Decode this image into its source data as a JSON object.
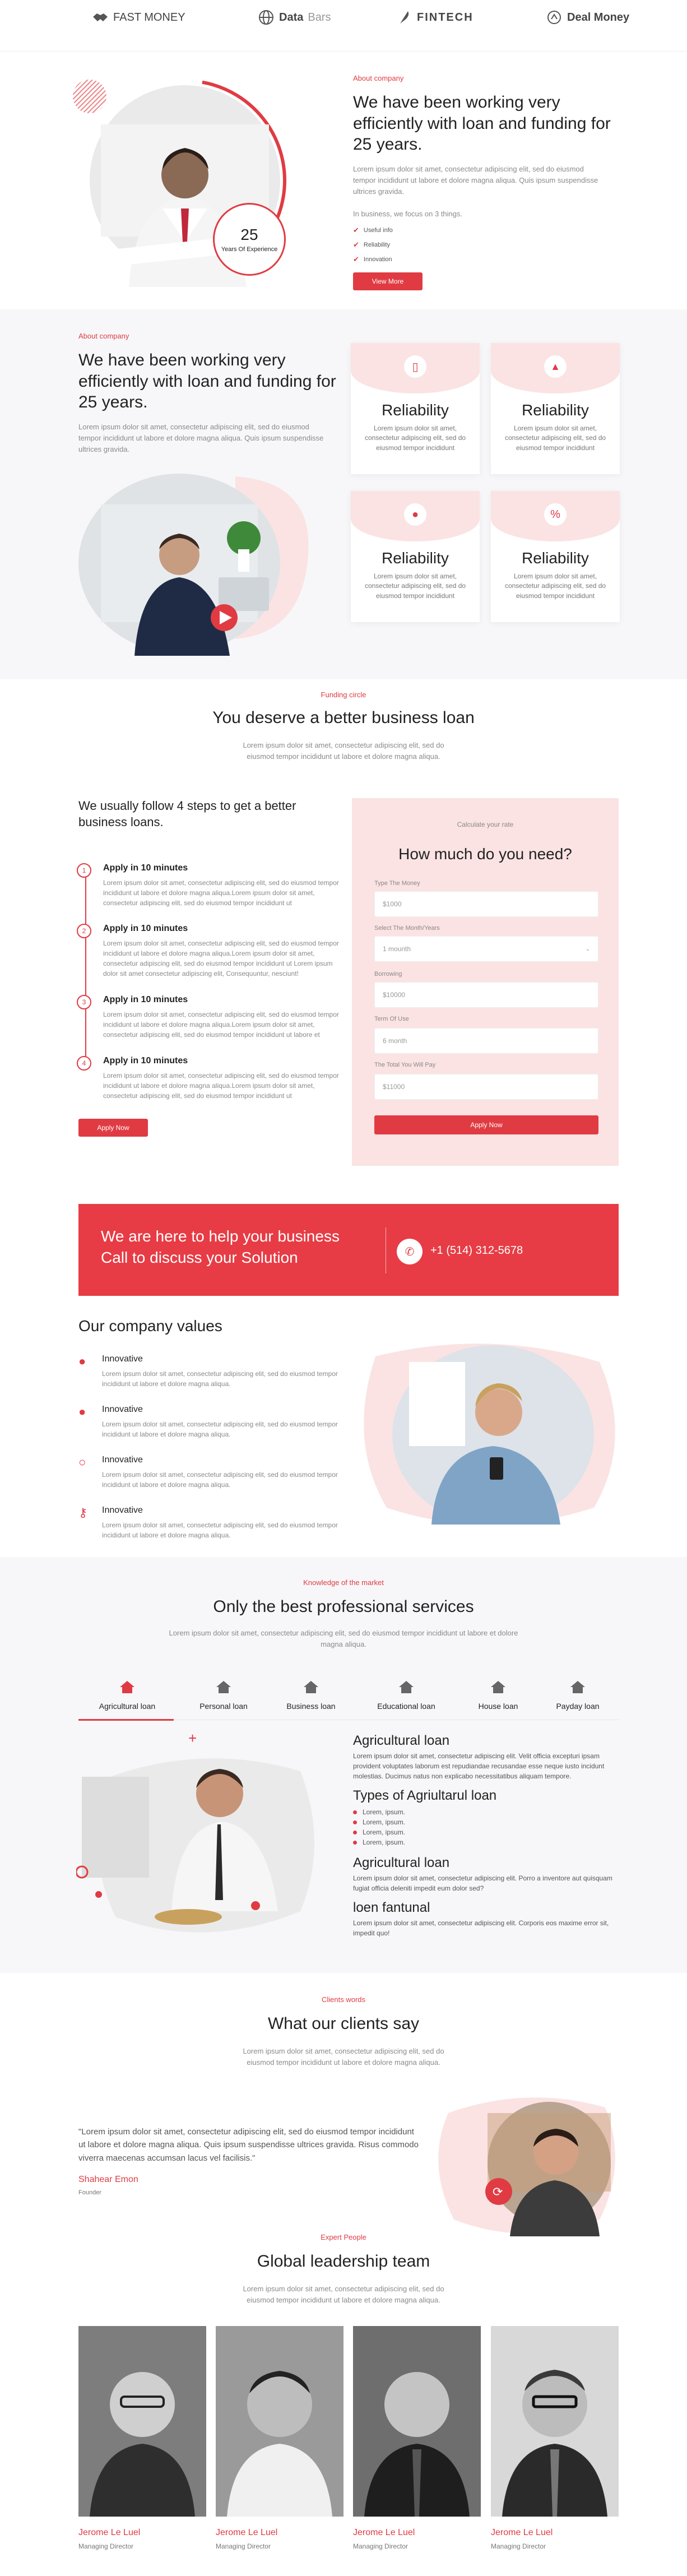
{
  "logos": [
    {
      "name": "FAST MONEY"
    },
    {
      "name_bold": "Data",
      "name_light": "Bars"
    },
    {
      "name": "FINTECH"
    },
    {
      "name": "Deal Money"
    }
  ],
  "about1": {
    "eyebrow": "About company",
    "title": "We have been working very efficiently with loan and funding for 25 years.",
    "body": "Lorem ipsum dolor sit amet, consectetur adipiscing elit, sed do eiusmod tempor incididunt ut labore et dolore magna aliqua. Quis ipsum suspendisse ultrices gravida.",
    "focus": "In business, we focus on 3 things.",
    "checks": [
      "Useful info",
      "Reliability",
      "Innovation"
    ],
    "button": "View More",
    "badge_num": "25",
    "badge_text": "Years Of Experience"
  },
  "about2": {
    "eyebrow": "About company",
    "title": "We have been working very efficiently with loan and funding for 25 years.",
    "body": "Lorem ipsum dolor sit amet, consectetur adipiscing elit, sed do eiusmod tempor incididunt ut labore et dolore magna aliqua. Quis ipsum suspendisse ultrices gravida.",
    "cards": [
      {
        "title": "Reliability",
        "desc": "Lorem ipsum dolor sit amet, consectetur adipiscing elit, sed do eiusmod tempor incididunt",
        "icon": "phone-icon"
      },
      {
        "title": "Reliability",
        "desc": "Lorem ipsum dolor sit amet, consectetur adipiscing elit, sed do eiusmod tempor incididunt",
        "icon": "rocket-icon"
      },
      {
        "title": "Reliability",
        "desc": "Lorem ipsum dolor sit amet, consectetur adipiscing elit, sed do eiusmod tempor incididunt",
        "icon": "apple-icon"
      },
      {
        "title": "Reliability",
        "desc": "Lorem ipsum dolor sit amet, consectetur adipiscing elit, sed do eiusmod tempor incididunt",
        "icon": "percent-icon"
      }
    ]
  },
  "funding": {
    "eyebrow": "Funding circle",
    "title": "You deserve a better business loan",
    "body": "Lorem ipsum dolor sit amet, consectetur adipiscing elit, sed do eiusmod tempor incididunt ut labore et dolore magna aliqua."
  },
  "steps": {
    "title": "We usually follow 4 steps to get a better business loans.",
    "items": [
      {
        "num": "1",
        "title": "Apply in 10 minutes",
        "desc": "Lorem ipsum dolor sit amet, consectetur adipiscing elit, sed do eiusmod tempor incididunt ut labore et dolore magna aliqua.Lorem ipsum dolor sit amet, consectetur adipiscing elit, sed do eiusmod tempor incididunt ut"
      },
      {
        "num": "2",
        "title": "Apply in 10 minutes",
        "desc": "Lorem ipsum dolor sit amet, consectetur adipiscing elit, sed do eiusmod tempor incididunt ut labore et dolore magna aliqua.Lorem ipsum dolor sit amet, consectetur adipiscing elit, sed do eiusmod tempor incididunt ut Lorem ipsum dolor sit amet consectetur adipiscing elit, Consequuntur, nesciunt!"
      },
      {
        "num": "3",
        "title": "Apply in 10 minutes",
        "desc": "Lorem ipsum dolor sit amet, consectetur adipiscing elit, sed do eiusmod tempor incididunt ut labore et dolore magna aliqua.Lorem ipsum dolor sit amet, consectetur adipiscing elit, sed do eiusmod tempor incididunt ut labore et"
      },
      {
        "num": "4",
        "title": "Apply in 10 minutes",
        "desc": "Lorem ipsum dolor sit amet, consectetur adipiscing elit, sed do eiusmod tempor incididunt ut labore et dolore magna aliqua.Lorem ipsum dolor sit amet, consectetur adipiscing elit, sed do eiusmod tempor incididunt ut"
      }
    ],
    "button": "Apply Now"
  },
  "calc": {
    "eyebrow": "Calculate your rate",
    "title": "How much do you need?",
    "fields": [
      {
        "label": "Type The Money",
        "value": "$1000"
      },
      {
        "label": "Select The Month/Years",
        "value": "1 mounth"
      },
      {
        "label": "Borrowing",
        "value": "$10000"
      },
      {
        "label": "Term Of Use",
        "value": "6 month"
      },
      {
        "label": "The Total You Will Pay",
        "value": "$11000"
      }
    ],
    "button": "Apply Now"
  },
  "cta": {
    "line1": "We are here to help your business",
    "line2": "Call to discuss your Solution",
    "phone": "+1 (514) 312-5678"
  },
  "values": {
    "title": "Our company values",
    "items": [
      {
        "title": "Innovative",
        "desc": "Lorem ipsum dolor sit amet, consectetur adipiscing elit, sed do eiusmod tempor incididunt ut labore et dolore magna aliqua."
      },
      {
        "title": "Innovative",
        "desc": "Lorem ipsum dolor sit amet, consectetur adipiscing elit, sed do eiusmod tempor incididunt ut labore et dolore magna aliqua."
      },
      {
        "title": "Innovative",
        "desc": "Lorem ipsum dolor sit amet, consectetur adipiscing elit, sed do eiusmod tempor incididunt ut labore et dolore magna aliqua."
      },
      {
        "title": "Innovative",
        "desc": "Lorem ipsum dolor sit amet, consectetur adipiscing elit, sed do eiusmod tempor incididunt ut labore et dolore magna aliqua."
      }
    ]
  },
  "services": {
    "eyebrow": "Knowledge of the market",
    "title": "Only the best professional services",
    "body": "Lorem ipsum dolor sit amet, consectetur adipiscing elit, sed do eiusmod tempor incididunt ut labore et dolore magna aliqua.",
    "tabs": [
      "Agricultural loan",
      "Personal loan",
      "Business loan",
      "Educational loan",
      "House loan",
      "Payday loan"
    ],
    "h1": "Agricultural loan",
    "p1": "Lorem ipsum dolor sit amet, consectetur adipiscing elit. Velit officia excepturi ipsam provident voluptates laborum est repudiandae recusandae esse neque iusto incidunt molestias. Ducimus natus non explicabo necessitatibus aliquam tempore.",
    "h2": "Types of Agriultarul loan",
    "list": [
      "Lorem, ipsum.",
      "Lorem, ipsum.",
      "Lorem, ipsum.",
      "Lorem, ipsum."
    ],
    "h3": "Agricultural loan",
    "p3": "Lorem ipsum dolor sit amet, consectetur adipiscing elit. Porro a inventore aut quisquam fugiat officia deleniti impedit eum dolor sed?",
    "h4": "loen fantunal",
    "p4": "Lorem ipsum dolor sit amet, consectetur adipiscing elit. Corporis eos maxime error sit, impedit quo!"
  },
  "clients": {
    "eyebrow": "Clients words",
    "title": "What our clients say",
    "body": "Lorem ipsum dolor sit amet, consectetur adipiscing elit, sed do eiusmod tempor incididunt ut labore et dolore magna aliqua.",
    "quote": "\"Lorem ipsum dolor sit amet, consectetur adipiscing elit, sed do eiusmod tempor incididunt ut labore et dolore magna aliqua. Quis ipsum suspendisse ultrices gravida. Risus commodo viverra maecenas accumsan lacus vel facilisis.\"",
    "name": "Shahear Emon",
    "role": "Founder"
  },
  "team": {
    "eyebrow": "Expert People",
    "title": "Global leadership team",
    "body": "Lorem ipsum dolor sit amet, consectetur adipiscing elit, sed do eiusmod tempor incididunt ut labore et dolore magna aliqua.",
    "members": [
      {
        "name": "Jerome Le Luel",
        "role": "Managing Director"
      },
      {
        "name": "Jerome Le Luel",
        "role": "Managing Director"
      },
      {
        "name": "Jerome Le Luel",
        "role": "Managing Director"
      },
      {
        "name": "Jerome Le Luel",
        "role": "Managing Director"
      }
    ]
  },
  "colors": {
    "accent": "#e03b43",
    "pink": "#fbe3e3",
    "band": "#f7f7f9"
  }
}
